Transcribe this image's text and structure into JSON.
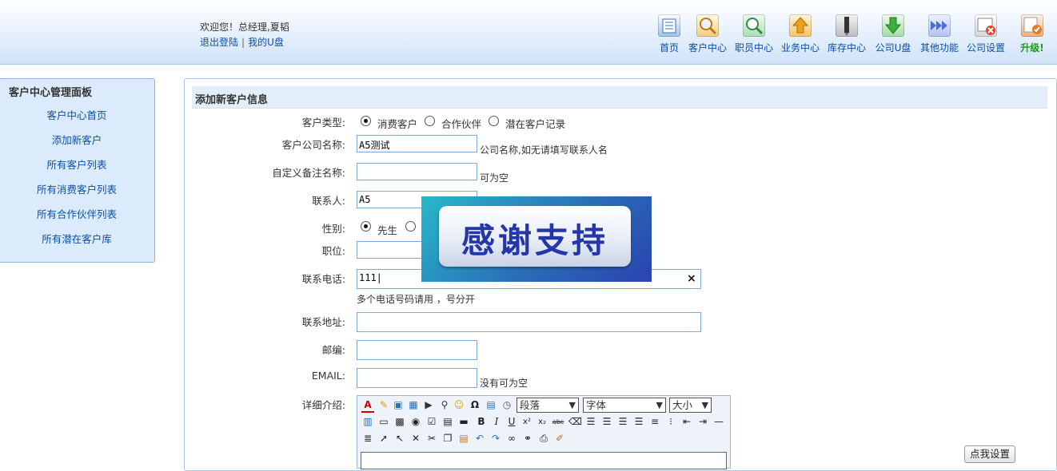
{
  "header": {
    "welcome": "欢迎您！总经理,夏韬",
    "logout": "退出登陆",
    "my_disk": "我的U盘",
    "sep": "|",
    "nav": [
      {
        "label": "首页",
        "icon": "home-list-icon",
        "color": "#5b8fd6"
      },
      {
        "label": "客户中心",
        "icon": "magnifier-icon",
        "color": "#e6a32b"
      },
      {
        "label": "职员中心",
        "icon": "magnifier-green-icon",
        "color": "#3aa35a"
      },
      {
        "label": "业务中心",
        "icon": "upload-arrow-icon",
        "color": "#f0a830"
      },
      {
        "label": "库存中心",
        "icon": "pen-icon",
        "color": "#444444"
      },
      {
        "label": "公司U盘",
        "icon": "download-arrow-icon",
        "color": "#3cae3c"
      },
      {
        "label": "其他功能",
        "icon": "arrows-right-icon",
        "color": "#4a6fd0"
      },
      {
        "label": "公司设置",
        "icon": "window-close-icon",
        "color": "#d94636"
      },
      {
        "label": "升级!",
        "icon": "upgrade-icon",
        "color": "#e07b2a"
      }
    ]
  },
  "sidebar": {
    "title": "客户中心管理面板",
    "items": [
      "客户中心首页",
      "添加新客户",
      "所有客户列表",
      "所有消费客户列表",
      "所有合作伙伴列表",
      "所有潜在客户库"
    ]
  },
  "form": {
    "title": "添加新客户信息",
    "customer_type_label": "客户类型:",
    "types": [
      "消费客户",
      "合作伙伴",
      "潜在客户记录"
    ],
    "selected_type": "消费客户",
    "company_label": "客户公司名称:",
    "company_value": "A5测试",
    "company_hint": "公司名称,如无请填写联系人名",
    "alias_label": "自定义备注名称:",
    "alias_value": "",
    "alias_hint": "可为空",
    "contact_label": "联系人:",
    "contact_value": "A5",
    "gender_label": "性别:",
    "genders": [
      "先生",
      ""
    ],
    "selected_gender": "先生",
    "position_label": "职位:",
    "position_value": "",
    "phone_label": "联系电话:",
    "phone_value": "111|",
    "phone_hint": "多个电话号码请用 ，号分开",
    "address_label": "联系地址:",
    "address_value": "",
    "zip_label": "邮编:",
    "zip_value": "",
    "email_label": "EMAIL:",
    "email_value": "",
    "email_hint": "没有可为空",
    "detail_label": "详细介绍:",
    "clear": "×"
  },
  "editor": {
    "paragraph": "段落",
    "font": "字体",
    "size": "大小"
  },
  "settings_button": "点我设置",
  "banner": {
    "text": "感谢支持"
  }
}
